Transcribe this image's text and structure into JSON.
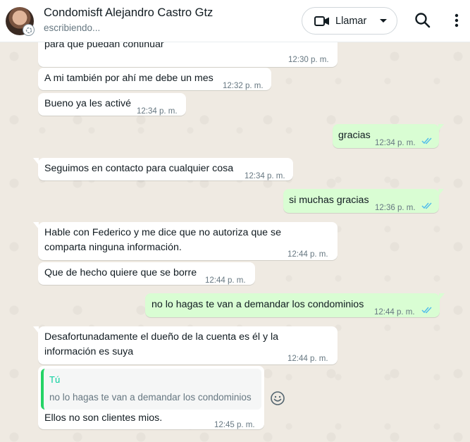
{
  "header": {
    "contact_name": "Condomisft Alejandro Castro Gtz",
    "status": "escribiendo...",
    "call_label": "Llamar"
  },
  "messages": [
    {
      "type": "in",
      "text_lines": [
        "para que puedan continuar"
      ],
      "time": "12:30 p. m."
    },
    {
      "type": "in",
      "text_lines": [
        "A mi también por ahí me debe un mes"
      ],
      "time": "12:32 p. m."
    },
    {
      "type": "in",
      "text_lines": [
        "Bueno ya les activé"
      ],
      "time": "12:34 p. m."
    },
    {
      "type": "out",
      "text_lines": [
        "gracias"
      ],
      "time": "12:34 p. m.",
      "read": true
    },
    {
      "type": "in",
      "text_lines": [
        "Seguimos en contacto para cualquier cosa"
      ],
      "time": "12:34 p. m."
    },
    {
      "type": "out",
      "text_lines": [
        "si muchas gracias"
      ],
      "time": "12:36 p. m.",
      "read": true
    },
    {
      "type": "in",
      "text_lines": [
        "Hable con Federico y me dice que no autoriza que se",
        "comparta ninguna información."
      ],
      "time": "12:44 p. m."
    },
    {
      "type": "in",
      "text_lines": [
        "Que de hecho quiere que se borre"
      ],
      "time": "12:44 p. m."
    },
    {
      "type": "out",
      "text_lines": [
        "no lo hagas te van a demandar los condominios"
      ],
      "time": "12:44 p. m.",
      "read": true
    },
    {
      "type": "in",
      "text_lines": [
        "Desafortunadamente el dueño de la cuenta es él y la",
        "información es suya"
      ],
      "time": "12:44 p. m."
    },
    {
      "type": "in",
      "quote": {
        "author": "Tú",
        "text": "no lo hagas te van a demandar los condominios"
      },
      "text_lines": [
        "Ellos no son clientes mios."
      ],
      "time": "12:45 p. m."
    }
  ],
  "colors": {
    "incoming_bubble": "#ffffff",
    "outgoing_bubble": "#d9fdd3",
    "read_ticks": "#53bdeb",
    "chat_background": "#efeae2",
    "quote_bar": "#25d366"
  },
  "icons": [
    "video-camera-icon",
    "chevron-down-icon",
    "search-icon",
    "more-vertical-icon",
    "emoji-icon",
    "double-check-icon"
  ]
}
